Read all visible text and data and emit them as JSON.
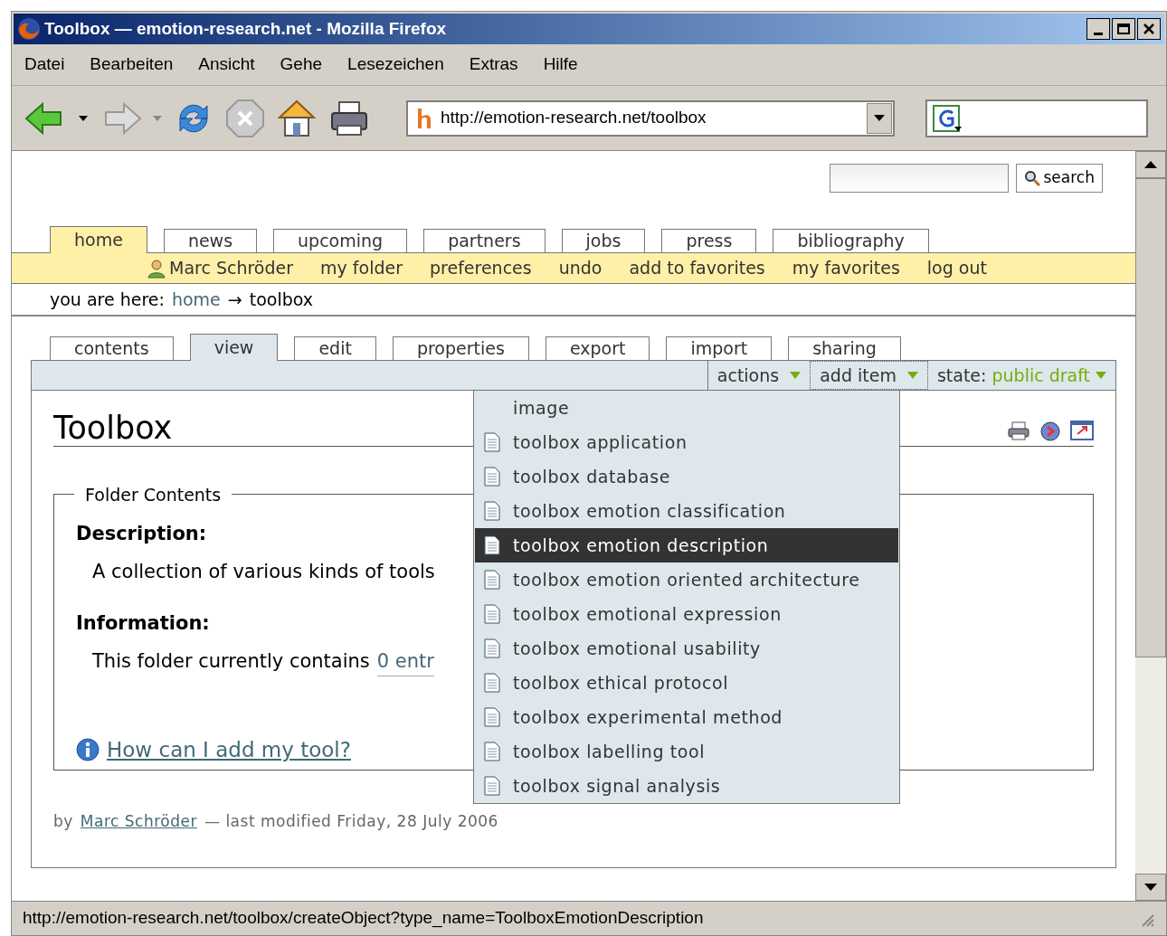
{
  "window": {
    "title": "Toolbox — emotion-research.net - Mozilla Firefox"
  },
  "menu": [
    "Datei",
    "Bearbeiten",
    "Ansicht",
    "Gehe",
    "Lesezeichen",
    "Extras",
    "Hilfe"
  ],
  "address_bar": {
    "url": "http://emotion-research.net/toolbox"
  },
  "page": {
    "search_button": "search",
    "nav_tabs": [
      {
        "label": "home",
        "selected": true
      },
      {
        "label": "news",
        "selected": false
      },
      {
        "label": "upcoming",
        "selected": false
      },
      {
        "label": "partners",
        "selected": false
      },
      {
        "label": "jobs",
        "selected": false
      },
      {
        "label": "press",
        "selected": false
      },
      {
        "label": "bibliography",
        "selected": false
      }
    ],
    "personal_bar": {
      "user": "Marc Schröder",
      "links": [
        "my folder",
        "preferences",
        "undo",
        "add to favorites",
        "my favorites",
        "log out"
      ]
    },
    "breadcrumb": {
      "label": "you are here:",
      "link": "home",
      "separator": "→",
      "current": "toolbox"
    },
    "content_tabs": [
      {
        "label": "contents",
        "selected": false
      },
      {
        "label": "view",
        "selected": true
      },
      {
        "label": "edit",
        "selected": false
      },
      {
        "label": "properties",
        "selected": false
      },
      {
        "label": "export",
        "selected": false
      },
      {
        "label": "import",
        "selected": false
      },
      {
        "label": "sharing",
        "selected": false
      }
    ],
    "action_bar": {
      "actions": "actions",
      "add_item": "add item",
      "state_label": "state:",
      "state_value": "public draft"
    },
    "title": "Toolbox",
    "folder_contents": {
      "legend": "Folder Contents",
      "description_label": "Description:",
      "description": "A collection of various kinds of tools",
      "information_label": "Information:",
      "information": "This folder currently contains",
      "entries_link": "0 entr",
      "help_link": "How can I add my tool?"
    },
    "byline": {
      "prefix": "by",
      "author": "Marc Schröder",
      "modified": "— last modified Friday, 28 July 2006"
    },
    "add_item_menu": [
      {
        "label": "image",
        "kind": "plain",
        "selected": false
      },
      {
        "label": "toolbox application",
        "kind": "document",
        "selected": false
      },
      {
        "label": "toolbox database",
        "kind": "document",
        "selected": false
      },
      {
        "label": "toolbox emotion classification",
        "kind": "document",
        "selected": false
      },
      {
        "label": "toolbox emotion description",
        "kind": "document",
        "selected": true
      },
      {
        "label": "toolbox emotion oriented architecture",
        "kind": "document",
        "selected": false
      },
      {
        "label": "toolbox emotional expression",
        "kind": "document",
        "selected": false
      },
      {
        "label": "toolbox emotional usability",
        "kind": "document",
        "selected": false
      },
      {
        "label": "toolbox ethical protocol",
        "kind": "document",
        "selected": false
      },
      {
        "label": "toolbox experimental method",
        "kind": "document",
        "selected": false
      },
      {
        "label": "toolbox labelling tool",
        "kind": "document",
        "selected": false
      },
      {
        "label": "toolbox signal analysis",
        "kind": "document",
        "selected": false
      }
    ]
  },
  "status_bar": {
    "text": "http://emotion-research.net/toolbox/createObject?type_name=ToolboxEmotionDescription"
  }
}
